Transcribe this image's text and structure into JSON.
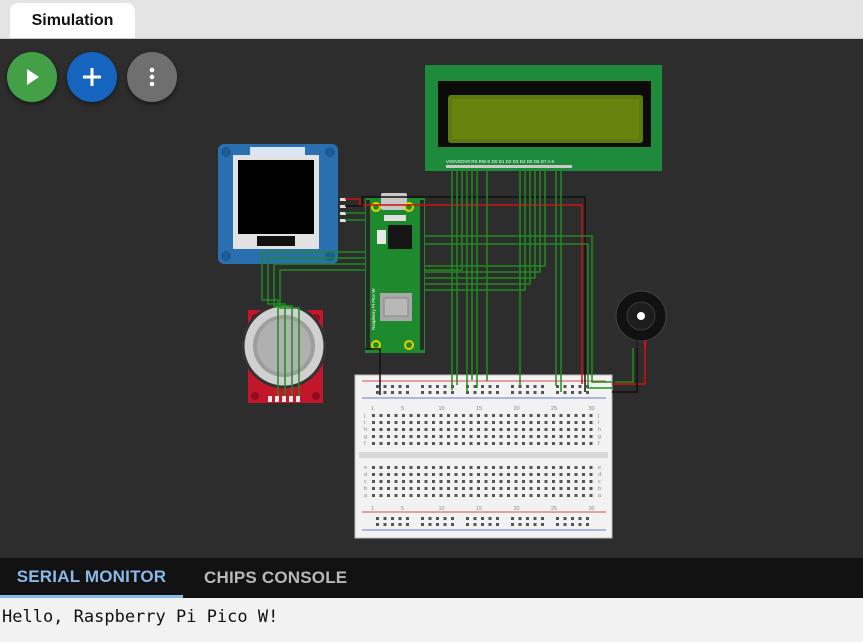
{
  "tabs": {
    "simulation": "Simulation"
  },
  "toolbar": {
    "run_icon": "play-icon",
    "add_icon": "plus-icon",
    "menu_icon": "more-vert-icon",
    "colors": {
      "run": "#43a047",
      "add": "#1565c0",
      "menu": "#6f6f6f"
    }
  },
  "parts": {
    "oled": "OLED display",
    "pico": "Raspberry Pi Pico W",
    "lcd": "LCD 1602",
    "joystick": "Analog Joystick",
    "buzzer": "Buzzer",
    "breadboard": "Breadboard"
  },
  "lcd_pins": "VSSVDDV0 RS RW E D0 D1 D2 D3 D4 D5 D6 D7 A K",
  "pico_label": "Raspberry Pi Pico W",
  "breadboard": {
    "column_numbers": [
      "1",
      "5",
      "10",
      "15",
      "20",
      "25",
      "30"
    ],
    "row_letters_top": [
      "j",
      "i",
      "h",
      "g",
      "f"
    ],
    "row_letters_bottom": [
      "e",
      "d",
      "c",
      "b",
      "a"
    ]
  },
  "bottom_panel": {
    "tabs": [
      "SERIAL MONITOR",
      "CHIPS CONSOLE"
    ],
    "active_tab": "SERIAL MONITOR",
    "output": "Hello, Raspberry Pi Pico W!"
  },
  "wire_colors": {
    "signal": "#1e8c1e",
    "power": "#d01010",
    "ground": "#111111"
  }
}
